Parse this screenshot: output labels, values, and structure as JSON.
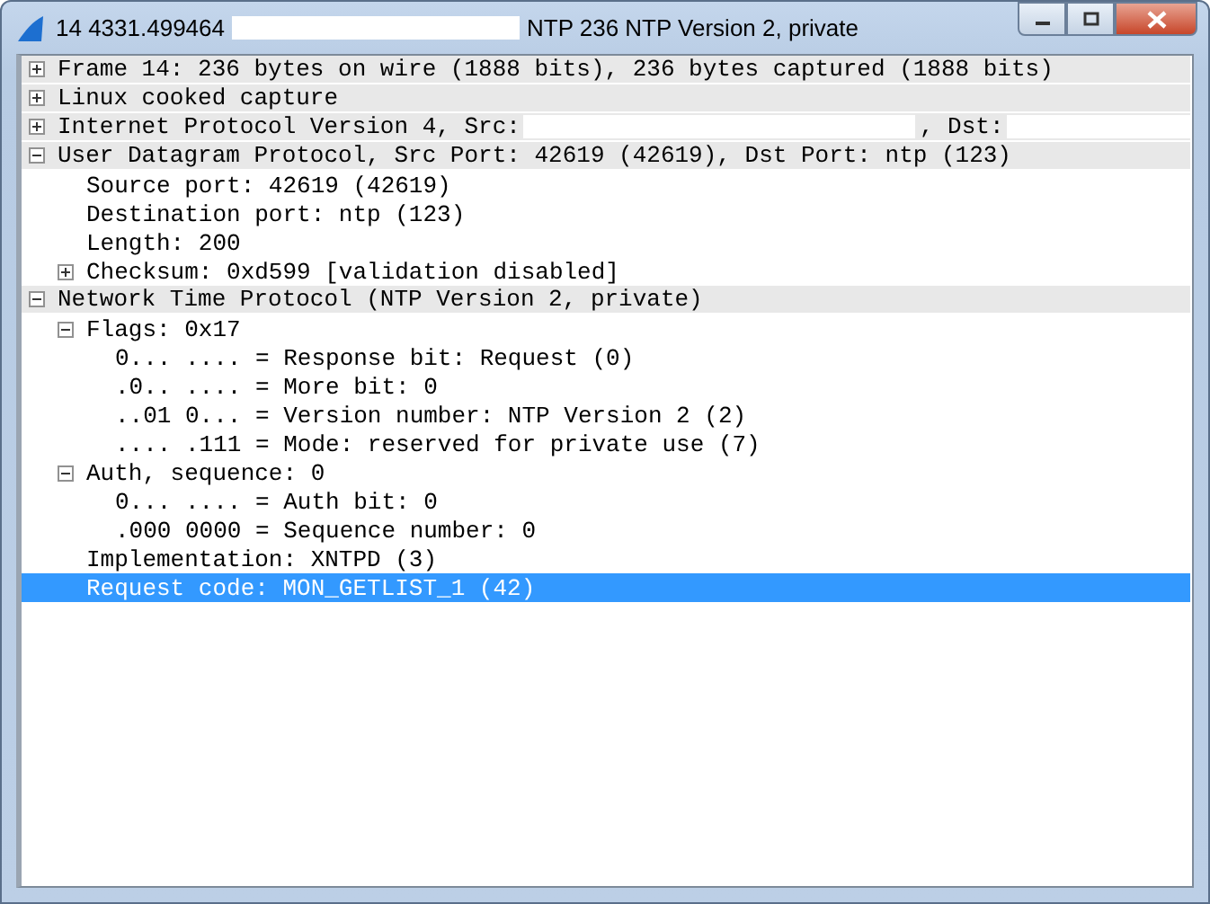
{
  "window": {
    "title_parts": [
      "14 4331.499464",
      "NTP 236 NTP Version 2, private"
    ]
  },
  "tree": [
    {
      "parts": [
        "Frame 14: 236 bytes on wire (1888 bits), 236 bytes captured (1888 bits)"
      ],
      "expanded": false,
      "selected": false
    },
    {
      "parts": [
        "Linux cooked capture"
      ],
      "expanded": false,
      "selected": false
    },
    {
      "parts": [
        "Internet Protocol Version 4, Src:",
        ", Dst:"
      ],
      "expanded": false,
      "selected": false
    },
    {
      "parts": [
        "User Datagram Protocol, Src Port: 42619 (42619), Dst Port: ntp (123)"
      ],
      "expanded": true,
      "selected": false,
      "children": [
        {
          "parts": [
            "Source port: 42619 (42619)"
          ],
          "selected": false
        },
        {
          "parts": [
            "Destination port: ntp (123)"
          ],
          "selected": false
        },
        {
          "parts": [
            "Length: 200"
          ],
          "selected": false
        },
        {
          "parts": [
            "Checksum: 0xd599 [validation disabled]"
          ],
          "expanded": false,
          "selected": false
        }
      ]
    },
    {
      "parts": [
        "Network Time Protocol (NTP Version 2, private)"
      ],
      "expanded": true,
      "selected": false,
      "children": [
        {
          "parts": [
            "Flags: 0x17"
          ],
          "expanded": true,
          "selected": false,
          "children": [
            {
              "parts": [
                "0... .... = Response bit: Request (0)"
              ],
              "selected": false
            },
            {
              "parts": [
                ".0.. .... = More bit: 0"
              ],
              "selected": false
            },
            {
              "parts": [
                "..01 0... = Version number: NTP Version 2 (2)"
              ],
              "selected": false
            },
            {
              "parts": [
                ".... .111 = Mode: reserved for private use (7)"
              ],
              "selected": false
            }
          ]
        },
        {
          "parts": [
            "Auth, sequence: 0"
          ],
          "expanded": true,
          "selected": false,
          "children": [
            {
              "parts": [
                "0... .... = Auth bit: 0"
              ],
              "selected": false
            },
            {
              "parts": [
                ".000 0000 = Sequence number: 0"
              ],
              "selected": false
            }
          ]
        },
        {
          "parts": [
            "Implementation: XNTPD (3)"
          ],
          "selected": false
        },
        {
          "parts": [
            "Request code: MON_GETLIST_1 (42)"
          ],
          "selected": true
        }
      ]
    }
  ]
}
